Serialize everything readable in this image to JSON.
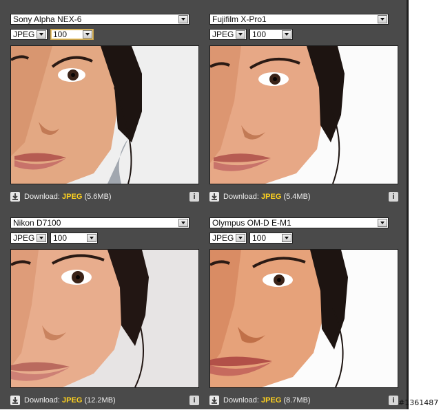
{
  "cells": [
    {
      "camera": "Sony Alpha NEX-6",
      "format": "JPEG",
      "quality": "100",
      "download_label": "Download:",
      "download_format": "JPEG",
      "download_size": "(5.6MB)",
      "info_label": "i"
    },
    {
      "camera": "Fujifilm X-Pro1",
      "format": "JPEG",
      "quality": "100",
      "download_label": "Download:",
      "download_format": "JPEG",
      "download_size": "(5.4MB)",
      "info_label": "i"
    },
    {
      "camera": "Nikon D7100",
      "format": "JPEG",
      "quality": "100",
      "download_label": "Download:",
      "download_format": "JPEG",
      "download_size": "(12.2MB)",
      "info_label": "i"
    },
    {
      "camera": "Olympus OM-D E-M1",
      "format": "JPEG",
      "quality": "100",
      "download_label": "Download:",
      "download_format": "JPEG",
      "download_size": "(8.7MB)",
      "info_label": "i"
    }
  ],
  "watermark": "#1361487",
  "colors": {
    "panel": "#4a4a4a",
    "format_highlight": "#ffd21f",
    "skin": "#e2a682",
    "background_white": "#f2f2f2"
  }
}
